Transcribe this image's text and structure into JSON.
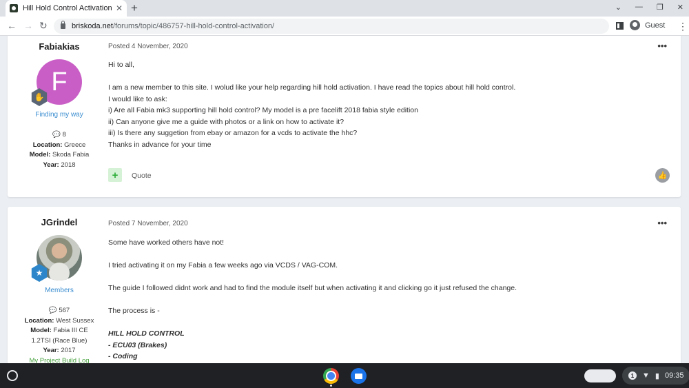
{
  "browser": {
    "tab_title": "Hill Hold Control Activation - Sk",
    "tab_close": "✕",
    "new_tab": "+",
    "url_host": "briskoda.net",
    "url_path": "/forums/topic/486757-hill-hold-control-activation/",
    "profile_label": "Guest"
  },
  "posts": [
    {
      "username": "Fabiakias",
      "avatar_letter": "F",
      "group": "Finding my way",
      "post_count": "8",
      "location_label": "Location:",
      "location": "Greece",
      "model_label": "Model:",
      "model": "Skoda Fabia",
      "year_label": "Year:",
      "year": "2018",
      "posted": "Posted 4 November, 2020",
      "lines": [
        "Hi to all,",
        "",
        "I am a new member to this site. I wolud like your help regarding hill hold activation. I have read the topics about hill hold control.",
        "I would like to ask:",
        "i) Are all Fabia mk3 supporting hill hold control? My model is a pre facelift 2018 fabia style edition",
        "ii) Can anyone give me a guide with photos or a link on how to activate it?",
        "iii) Is there any suggetion from ebay or amazon for a vcds to activate the hhc?",
        "Thanks in advance for your time"
      ],
      "quote_label": "Quote"
    },
    {
      "username": "JGrindel",
      "group": "Members",
      "post_count": "567",
      "location_label": "Location:",
      "location": "West Sussex",
      "model_label": "Model:",
      "model": "Fabia III CE",
      "model_line2": "1.2TSI (Race Blue)",
      "year_label": "Year:",
      "year": "2017",
      "build_log": "My Project Build Log",
      "posted": "Posted 7 November, 2020",
      "lines": [
        "Some have worked others have not!",
        "",
        "I tried activating it on my Fabia a few weeks ago via VCDS / VAG-COM.",
        "",
        "The guide I followed didnt work and had to find the module itself but when activating it and clicking go it just refused the change.",
        "",
        "The process is -",
        ""
      ],
      "bold_lines": [
        "HILL HOLD CONTROL",
        "- ECU03 (Brakes)",
        "- Coding"
      ]
    }
  ],
  "shelf": {
    "notification_count": "1",
    "time": "09:35"
  },
  "colors": {
    "avatar_f": "#c95fc6",
    "group_link": "#3a8dd0",
    "build_log_link": "#48a23f"
  }
}
